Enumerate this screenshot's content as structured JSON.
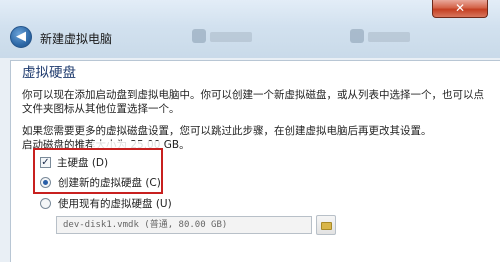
{
  "window": {
    "title": "新建虚拟电脑",
    "close_glyph": "✕",
    "back_glyph": "◀"
  },
  "page": {
    "heading": "虚拟硬盘",
    "intro_line1": "你可以现在添加启动盘到虚拟电脑中。你可以创建一个新虚拟磁盘，或从列表中选择一个，也可以点",
    "intro_line2": "文件夹图标从其他位置选择一个。",
    "advice_line": "如果您需要更多的虚拟磁盘设置，您可以跳过此步骤，在创建虚拟电脑后再更改其设置。",
    "recommended_size": "启动磁盘的推荐大小为 25.00 GB。"
  },
  "options": {
    "boot_disk_label": "主硬盘 (D)",
    "boot_disk_checked": true,
    "create_new_label": "创建新的虚拟硬盘 (C)",
    "use_existing_label": "使用现有的虚拟硬盘 (U)",
    "selected_option": "create_new",
    "checkbox_glyph": "✓"
  },
  "existing_disk": {
    "value": "dev-disk1.vmdk (普通, 80.00 GB)"
  },
  "colors": {
    "accent": "#c8201f",
    "heading": "#1f3b6e"
  }
}
